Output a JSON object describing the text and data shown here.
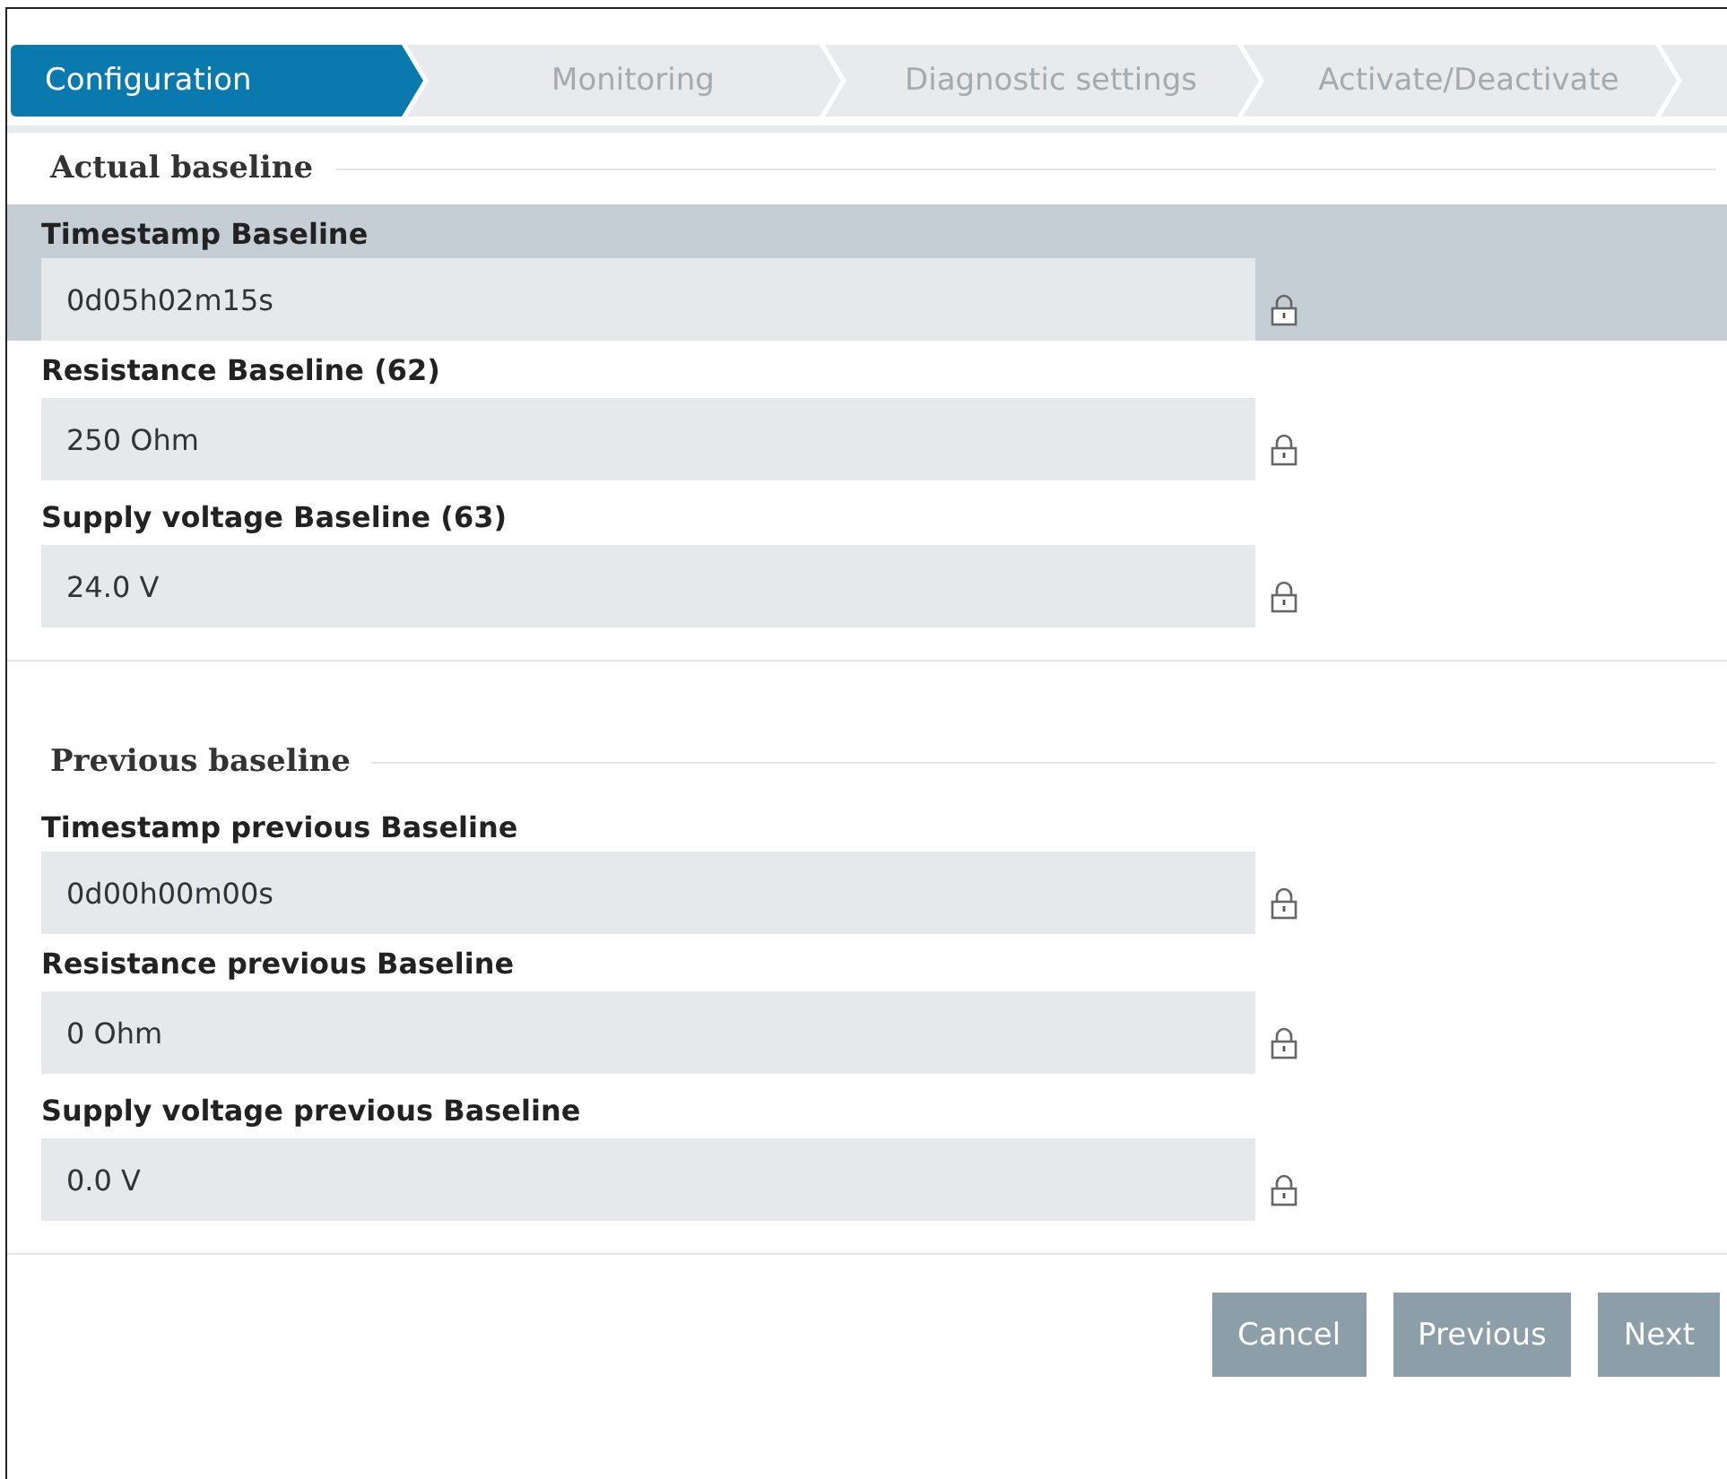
{
  "steps": [
    {
      "label": "Configuration",
      "selected": true
    },
    {
      "label": "Monitoring",
      "selected": false
    },
    {
      "label": "Diagnostic settings",
      "selected": false
    },
    {
      "label": "Activate/Deactivate",
      "selected": false
    }
  ],
  "groups": [
    {
      "legend": "Actual baseline",
      "fields": [
        {
          "label": "Timestamp Baseline",
          "value": "0d05h02m15s",
          "locked": true,
          "selected": true
        },
        {
          "label": "Resistance Baseline (62)",
          "value": "250 Ohm",
          "locked": true,
          "selected": false
        },
        {
          "label": "Supply voltage Baseline (63)",
          "value": "24.0 V",
          "locked": true,
          "selected": false
        }
      ]
    },
    {
      "legend": "Previous baseline",
      "fields": [
        {
          "label": "Timestamp previous Baseline",
          "value": "0d00h00m00s",
          "locked": true,
          "selected": false
        },
        {
          "label": "Resistance previous Baseline",
          "value": "0 Ohm",
          "locked": true,
          "selected": false
        },
        {
          "label": "Supply voltage previous Baseline",
          "value": "0.0 V",
          "locked": true,
          "selected": false
        }
      ]
    }
  ],
  "buttons": [
    "Cancel",
    "Previous",
    "Next"
  ]
}
